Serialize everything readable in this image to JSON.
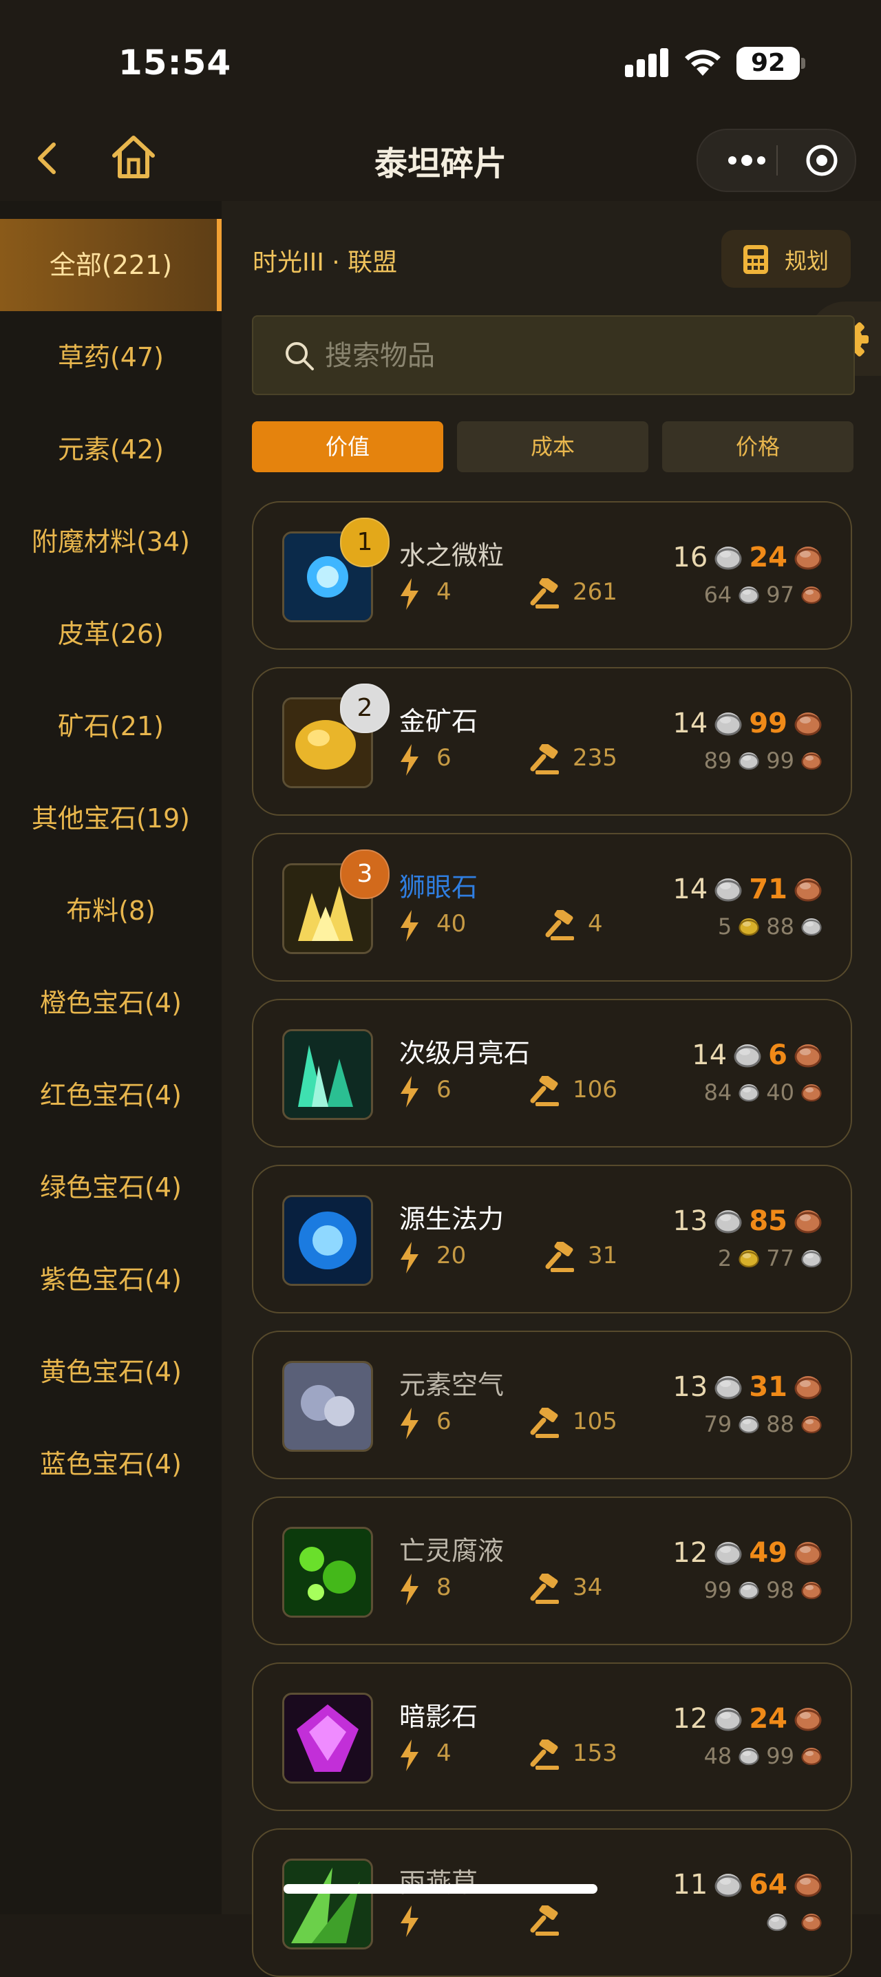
{
  "status_bar": {
    "time": "15:54",
    "battery": "92"
  },
  "nav": {
    "title": "泰坦碎片"
  },
  "sidebar": {
    "items": [
      {
        "label": "全部(221)",
        "active": true
      },
      {
        "label": "草药(47)"
      },
      {
        "label": "元素(42)"
      },
      {
        "label": "附魔材料(34)"
      },
      {
        "label": "皮革(26)"
      },
      {
        "label": "矿石(21)"
      },
      {
        "label": "其他宝石(19)"
      },
      {
        "label": "布料(8)"
      },
      {
        "label": "橙色宝石(4)"
      },
      {
        "label": "红色宝石(4)"
      },
      {
        "label": "绿色宝石(4)"
      },
      {
        "label": "紫色宝石(4)"
      },
      {
        "label": "黄色宝石(4)"
      },
      {
        "label": "蓝色宝石(4)"
      }
    ]
  },
  "main": {
    "realm": "时光III · 联盟",
    "plan_label": "规划",
    "search": {
      "placeholder": "搜索物品"
    },
    "tabs": [
      {
        "label": "价值",
        "active": true
      },
      {
        "label": "成本"
      },
      {
        "label": "价格"
      }
    ],
    "items": [
      {
        "rank": "1",
        "name": "水之微粒",
        "name_color": "#d8d2c4",
        "speed": "4",
        "sold": "261",
        "price_silver": "16",
        "price_copper": "24",
        "sub_a": "64",
        "sub_b": "97",
        "sub_a_coin": "silver",
        "sub_b_coin": "copper",
        "icon": "water-mote-icon"
      },
      {
        "rank": "2",
        "name": "金矿石",
        "name_color": "#ffffff",
        "speed": "6",
        "sold": "235",
        "price_silver": "14",
        "price_copper": "99",
        "sub_a": "89",
        "sub_b": "99",
        "sub_a_coin": "silver",
        "sub_b_coin": "copper",
        "icon": "gold-ore-icon"
      },
      {
        "rank": "3",
        "name": "狮眼石",
        "name_color": "#2f7ee0",
        "speed": "40",
        "sold": "4",
        "price_silver": "14",
        "price_copper": "71",
        "sub_a": "5",
        "sub_b": "88",
        "sub_a_coin": "gold",
        "sub_b_coin": "silver",
        "icon": "lions-eye-icon"
      },
      {
        "rank": "",
        "name": "次级月亮石",
        "name_color": "#ffffff",
        "speed": "6",
        "sold": "106",
        "price_silver": "14",
        "price_copper": "6",
        "sub_a": "84",
        "sub_b": "40",
        "sub_a_coin": "silver",
        "sub_b_coin": "copper",
        "icon": "moonstone-icon"
      },
      {
        "rank": "",
        "name": "源生法力",
        "name_color": "#ffffff",
        "speed": "20",
        "sold": "31",
        "price_silver": "13",
        "price_copper": "85",
        "sub_a": "2",
        "sub_b": "77",
        "sub_a_coin": "gold",
        "sub_b_coin": "silver",
        "icon": "primal-mana-icon"
      },
      {
        "rank": "",
        "name": "元素空气",
        "name_color": "#bdb7aa",
        "speed": "6",
        "sold": "105",
        "price_silver": "13",
        "price_copper": "31",
        "sub_a": "79",
        "sub_b": "88",
        "sub_a_coin": "silver",
        "sub_b_coin": "copper",
        "icon": "elemental-air-icon"
      },
      {
        "rank": "",
        "name": "亡灵腐液",
        "name_color": "#bdb7aa",
        "speed": "8",
        "sold": "34",
        "price_silver": "12",
        "price_copper": "49",
        "sub_a": "99",
        "sub_b": "98",
        "sub_a_coin": "silver",
        "sub_b_coin": "copper",
        "icon": "ichor-icon"
      },
      {
        "rank": "",
        "name": "暗影石",
        "name_color": "#ffffff",
        "speed": "4",
        "sold": "153",
        "price_silver": "12",
        "price_copper": "24",
        "sub_a": "48",
        "sub_b": "99",
        "sub_a_coin": "silver",
        "sub_b_coin": "copper",
        "icon": "shadowgem-icon"
      },
      {
        "rank": "",
        "name": "雨燕草",
        "name_color": "#bdb7aa",
        "speed": "",
        "sold": "",
        "price_silver": "11",
        "price_copper": "64",
        "sub_a": "",
        "sub_b": "",
        "sub_a_coin": "silver",
        "sub_b_coin": "copper",
        "icon": "swiftthistle-icon"
      }
    ]
  },
  "colors": {
    "accent": "#e5830d",
    "gold_text": "#e8b64d",
    "rank1": "#e3a81a",
    "rank2": "#dcdcdc",
    "rank3": "#d26a1c"
  }
}
